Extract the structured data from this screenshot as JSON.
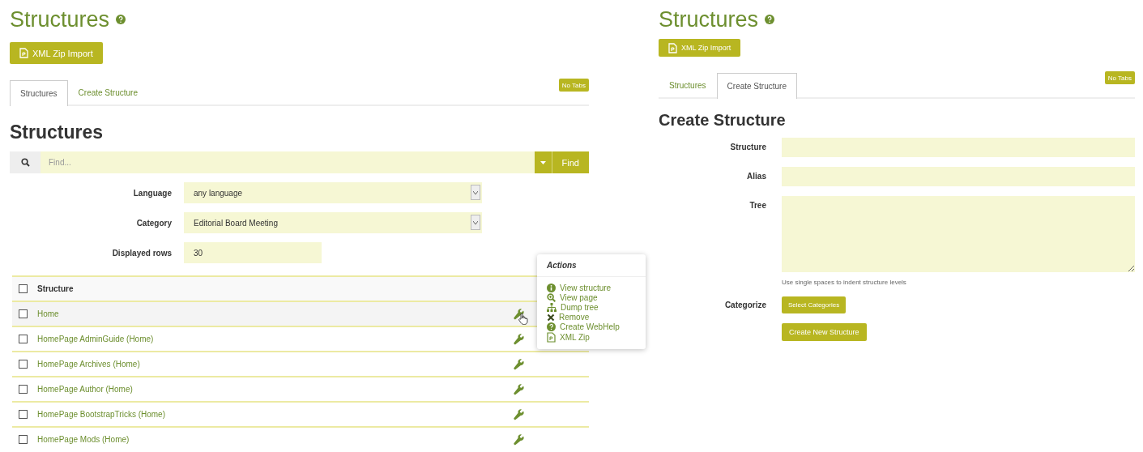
{
  "panels": [
    {
      "kind": "list",
      "title": "Structures",
      "import_button": "XML Zip Import",
      "tabs": [
        {
          "label": "Structures",
          "selected": true
        },
        {
          "label": "Create Structure",
          "selected": false
        }
      ],
      "no_tabs_button": "No Tabs",
      "heading": "Structures",
      "search": {
        "placeholder": "Find...",
        "button": "Find"
      },
      "filters": [
        {
          "kind": "select",
          "label": "Language",
          "value": "any language"
        },
        {
          "kind": "select",
          "label": "Category",
          "value": "Editorial Board Meeting"
        },
        {
          "kind": "text",
          "label": "Displayed rows",
          "value": "30"
        }
      ],
      "table": {
        "columns": [
          "Structure"
        ],
        "header_checked": false,
        "rows": [
          {
            "name": "Home",
            "checked": false,
            "hovered": true
          },
          {
            "name": "HomePage AdminGuide (Home)",
            "checked": false,
            "hovered": false
          },
          {
            "name": "HomePage Archives (Home)",
            "checked": false,
            "hovered": false
          },
          {
            "name": "HomePage Author (Home)",
            "checked": false,
            "hovered": false
          },
          {
            "name": "HomePage BootstrapTricks (Home)",
            "checked": false,
            "hovered": false
          },
          {
            "name": "HomePage Mods (Home)",
            "checked": false,
            "hovered": false
          }
        ]
      },
      "actions_menu": {
        "title": "Actions",
        "items": [
          "View structure",
          "View page",
          "Dump tree",
          "Remove",
          "Create WebHelp",
          "XML Zip"
        ]
      }
    },
    {
      "kind": "create",
      "title": "Structures",
      "import_button": "XML Zip Import",
      "tabs": [
        {
          "label": "Structures",
          "selected": false
        },
        {
          "label": "Create Structure",
          "selected": true
        }
      ],
      "no_tabs_button": "No Tabs",
      "heading": "Create Structure",
      "fields": [
        {
          "kind": "text",
          "label": "Structure"
        },
        {
          "kind": "text",
          "label": "Alias"
        },
        {
          "kind": "textarea",
          "label": "Tree",
          "hint": "Use single spaces to indent structure levels"
        },
        {
          "kind": "button",
          "label": "Categorize",
          "button": "Select Categories"
        }
      ],
      "submit_button": "Create New Structure"
    }
  ]
}
